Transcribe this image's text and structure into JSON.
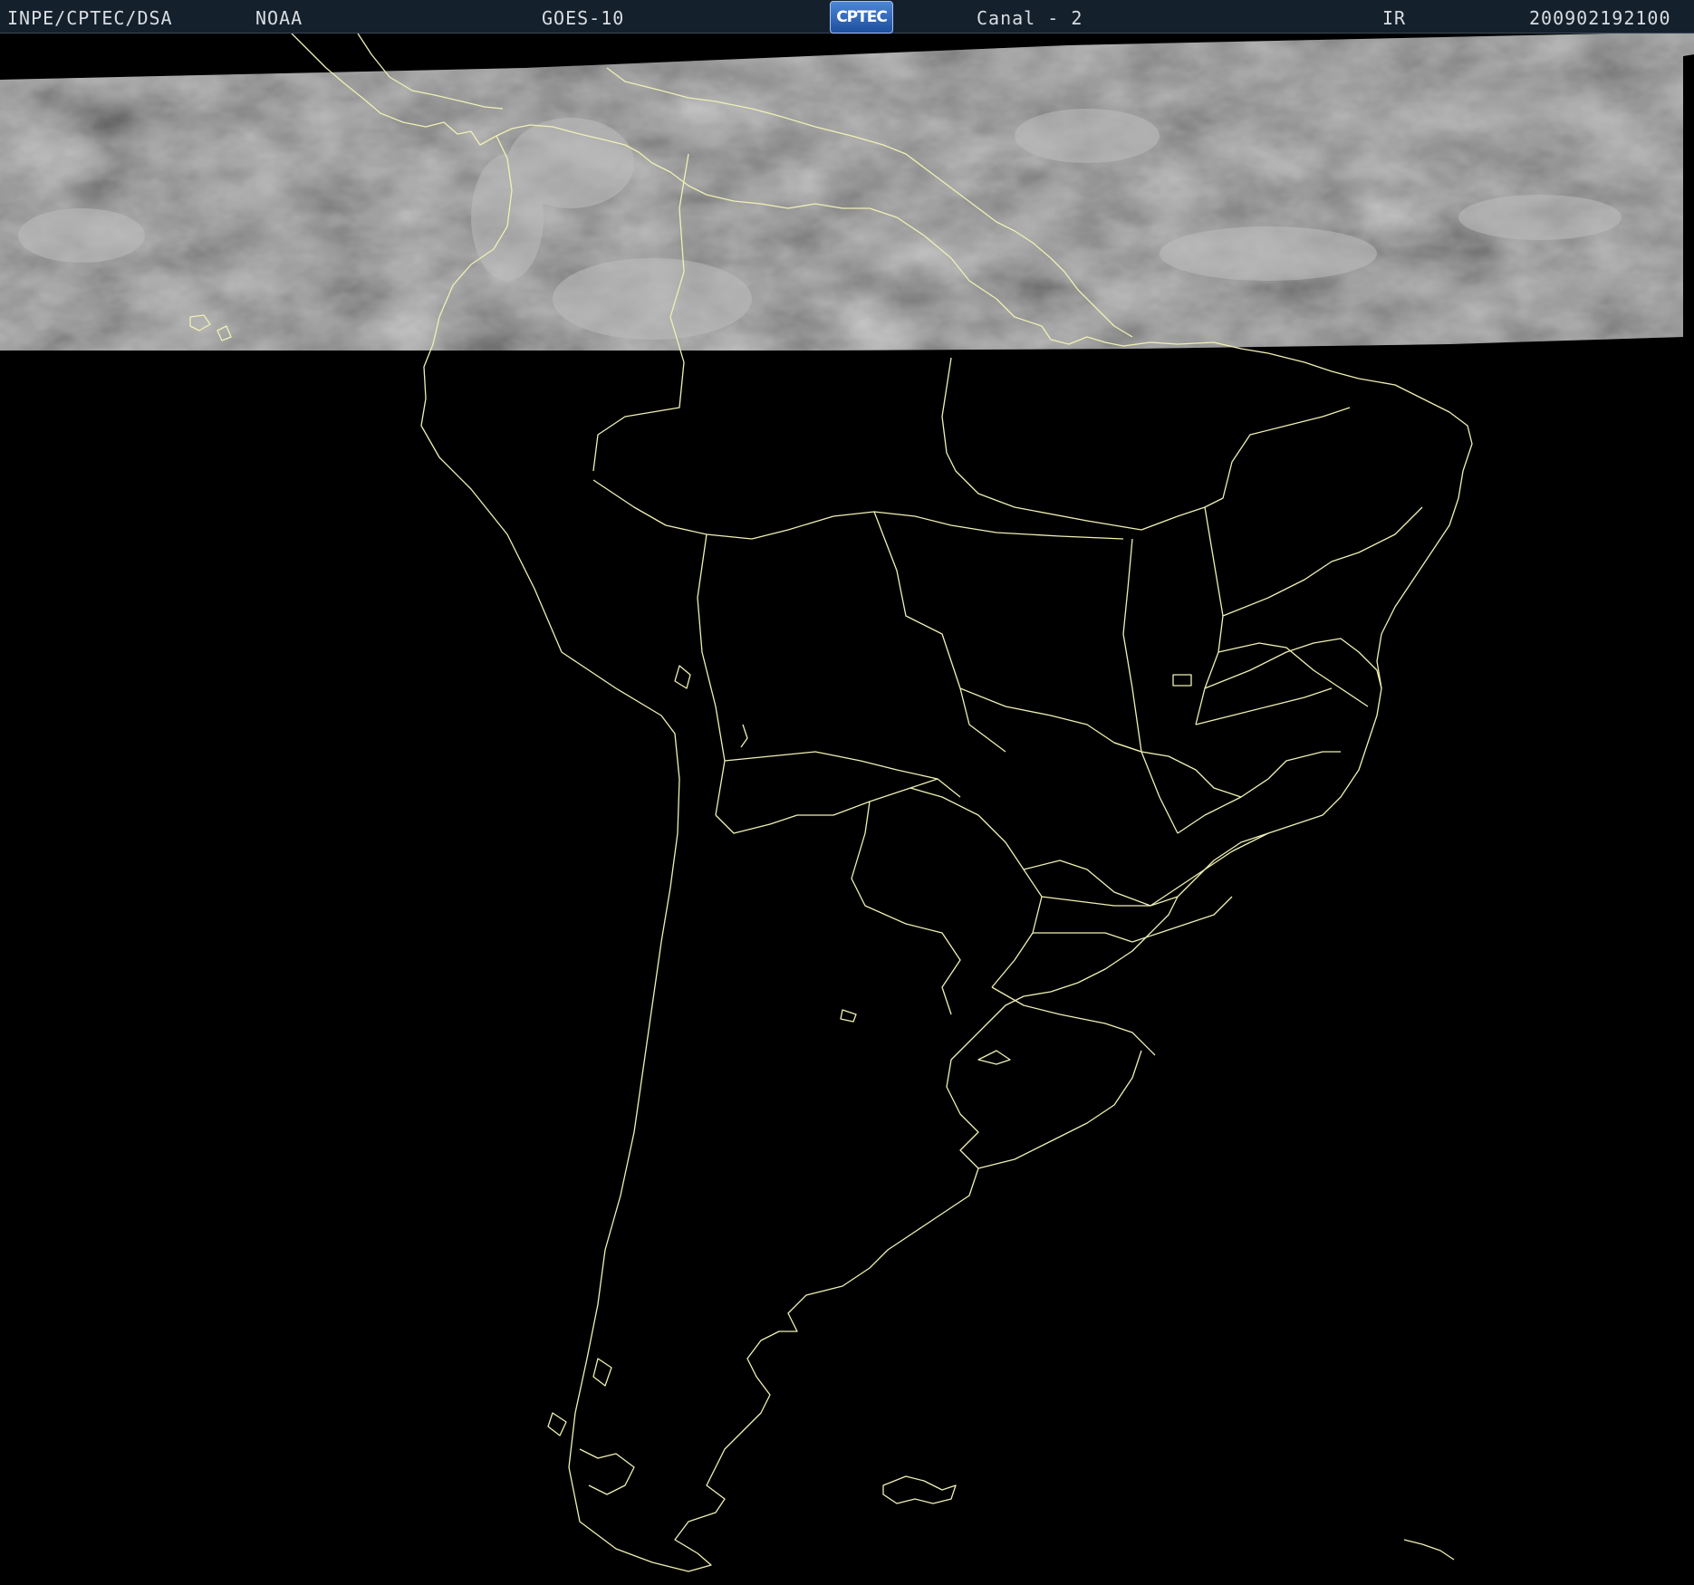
{
  "header": {
    "agency": "INPE/CPTEC/DSA",
    "provider": "NOAA",
    "satellite": "GOES-10",
    "logo_text": "CPTEC",
    "channel": "Canal - 2",
    "band": "IR",
    "timestamp": "200902192100"
  },
  "colors": {
    "header_bg": "#14202c",
    "header_text": "#d9dde2",
    "map_background": "#000000",
    "coastline": "#f0f0b4",
    "imagery_band": "#3a3a3a"
  },
  "map": {
    "region": "South America",
    "coverage": "satellite imagery covers only the northern strip; rest is black"
  }
}
